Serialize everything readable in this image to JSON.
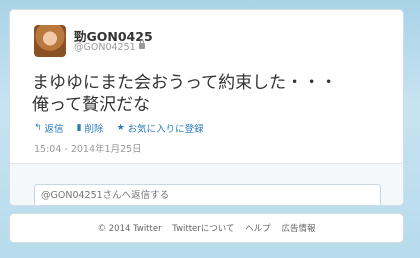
{
  "tweet": {
    "display_name": "勁GON0425",
    "handle": "@GON04251",
    "text_line1": "まゆゆにまた会おうって約束した・・・",
    "text_line2": "俺って贅沢だな",
    "timestamp": "15:04 - 2014年1月25日"
  },
  "actions": {
    "reply": {
      "icon": "reply-arrow-icon",
      "label": "返信"
    },
    "delete": {
      "icon": "trash-icon",
      "label": "削除"
    },
    "favorite": {
      "icon": "star-icon",
      "label": "お気に入りに登録"
    }
  },
  "reply": {
    "placeholder": "@GON04251さんへ返信する"
  },
  "footer": {
    "copyright": "© 2014 Twitter",
    "links": [
      "Twitterについて",
      "ヘルプ",
      "広告情報"
    ]
  },
  "colors": {
    "link": "#2b7bb9",
    "background_top": "#a9d3e8"
  }
}
